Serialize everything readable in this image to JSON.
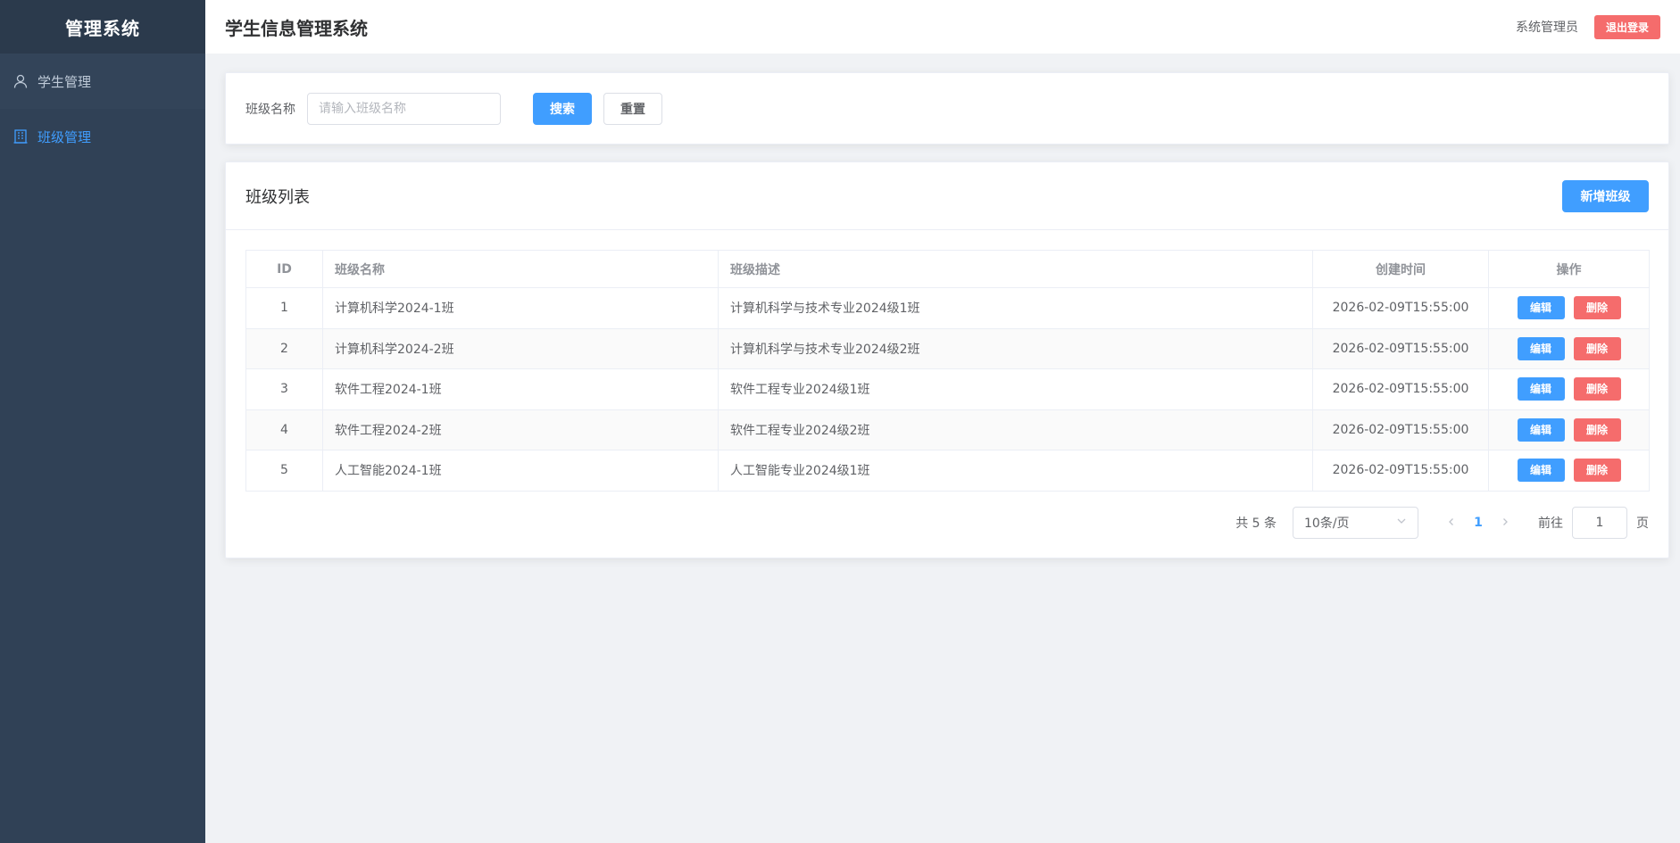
{
  "sidebar": {
    "brand": "管理系统",
    "items": [
      {
        "label": "学生管理"
      },
      {
        "label": "班级管理"
      }
    ]
  },
  "header": {
    "title": "学生信息管理系统",
    "user": "系统管理员",
    "logout_label": "退出登录"
  },
  "search": {
    "label": "班级名称",
    "placeholder": "请输入班级名称",
    "search_label": "搜索",
    "reset_label": "重置"
  },
  "list": {
    "title": "班级列表",
    "add_label": "新增班级",
    "columns": [
      "ID",
      "班级名称",
      "班级描述",
      "创建时间",
      "操作"
    ],
    "rows": [
      {
        "id": "1",
        "name": "计算机科学2024-1班",
        "desc": "计算机科学与技术专业2024级1班",
        "created": "2026-02-09T15:55:00"
      },
      {
        "id": "2",
        "name": "计算机科学2024-2班",
        "desc": "计算机科学与技术专业2024级2班",
        "created": "2026-02-09T15:55:00"
      },
      {
        "id": "3",
        "name": "软件工程2024-1班",
        "desc": "软件工程专业2024级1班",
        "created": "2026-02-09T15:55:00"
      },
      {
        "id": "4",
        "name": "软件工程2024-2班",
        "desc": "软件工程专业2024级2班",
        "created": "2026-02-09T15:55:00"
      },
      {
        "id": "5",
        "name": "人工智能2024-1班",
        "desc": "人工智能专业2024级1班",
        "created": "2026-02-09T15:55:00"
      }
    ],
    "edit_label": "编辑",
    "delete_label": "删除"
  },
  "pagination": {
    "total": "共 5 条",
    "page_size": "10条/页",
    "current_page": "1",
    "goto_label": "前往",
    "goto_value": "1",
    "page_suffix": "页"
  },
  "colors": {
    "sidebar_bg": "#304156",
    "primary": "#409eff",
    "danger": "#f56c6c"
  },
  "icons": {
    "student_menu": "user-icon",
    "class_menu": "building-icon",
    "prev": "chevron-left-icon",
    "next": "chevron-right-icon",
    "select": "chevron-down-icon"
  }
}
